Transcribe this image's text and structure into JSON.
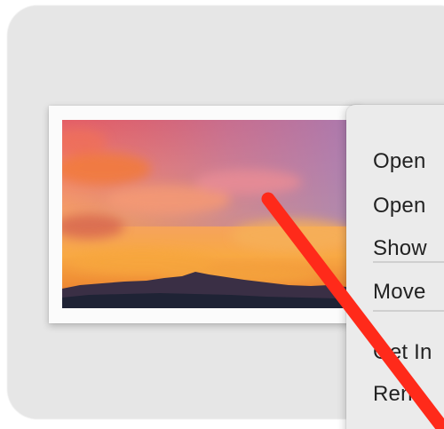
{
  "context_menu": {
    "items": [
      {
        "label": "Open"
      },
      {
        "label": "Open"
      },
      {
        "label": "Show"
      },
      {
        "label": "Move"
      },
      {
        "label": "Get In"
      },
      {
        "label": "Ren"
      }
    ]
  },
  "photo": {
    "subject": "sunset-over-mountains",
    "sky_colors": [
      "#e56b66",
      "#f2956e",
      "#f7a13a"
    ],
    "mountain_color": "#232a3e"
  },
  "annotation": {
    "color": "#ff2a1a",
    "shape": "diagonal-strike-line"
  },
  "colors": {
    "background": "#e6e6e6",
    "menu_background": "#ebebeb",
    "card_background": "#fbfbfb"
  }
}
